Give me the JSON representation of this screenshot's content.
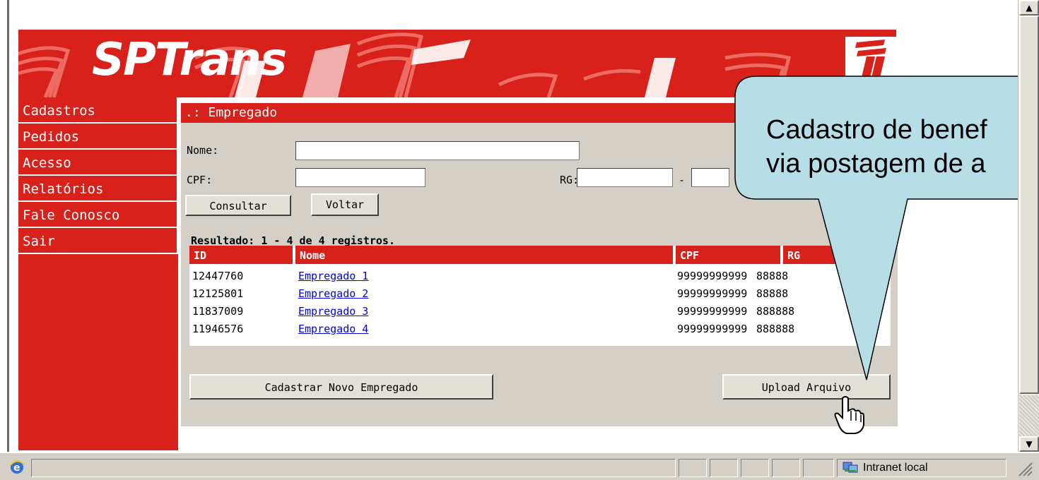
{
  "banner": {
    "title": "SPTrans",
    "logo_text": "SPTrans",
    "brand_color": "#d8211b"
  },
  "sidebar": {
    "items": [
      {
        "label": "Cadastros"
      },
      {
        "label": "Pedidos"
      },
      {
        "label": "Acesso"
      },
      {
        "label": "Relatórios"
      },
      {
        "label": "Fale Conosco"
      },
      {
        "label": "Sair"
      }
    ]
  },
  "panel": {
    "title": ".: Empregado",
    "form": {
      "nome_label": "Nome:",
      "nome_value": "",
      "cpf_label": "CPF:",
      "cpf_value": "",
      "rg_label": "RG:",
      "rg_value": "",
      "rg_separator": "-",
      "rg_digit_value": ""
    },
    "buttons": {
      "consultar": "Consultar",
      "voltar": "Voltar",
      "novo": "Cadastrar Novo Empregado",
      "upload": "Upload Arquivo"
    },
    "results": {
      "summary": "Resultado: 1 - 4 de 4 registros.",
      "columns": [
        "ID",
        "Nome",
        "CPF",
        "RG"
      ],
      "rows": [
        {
          "id": "12447760",
          "nome": "Empregado 1",
          "cpf": "99999999999",
          "rg": "88888"
        },
        {
          "id": "12125801",
          "nome": "Empregado 2",
          "cpf": "99999999999",
          "rg": "88888"
        },
        {
          "id": "11837009",
          "nome": "Empregado 3",
          "cpf": "99999999999",
          "rg": "888888"
        },
        {
          "id": "11946576",
          "nome": "Empregado 4",
          "cpf": "99999999999",
          "rg": "888888"
        }
      ]
    }
  },
  "callout": {
    "line1": "Cadastro de benef",
    "line2": "via postagem de a",
    "fill_color": "#b7dde6"
  },
  "statusbar": {
    "zone_label": "Intranet local"
  },
  "icons": {
    "browser": "ie-icon",
    "zone": "intranet-zone-icon",
    "cursor": "hand-pointer-icon"
  }
}
